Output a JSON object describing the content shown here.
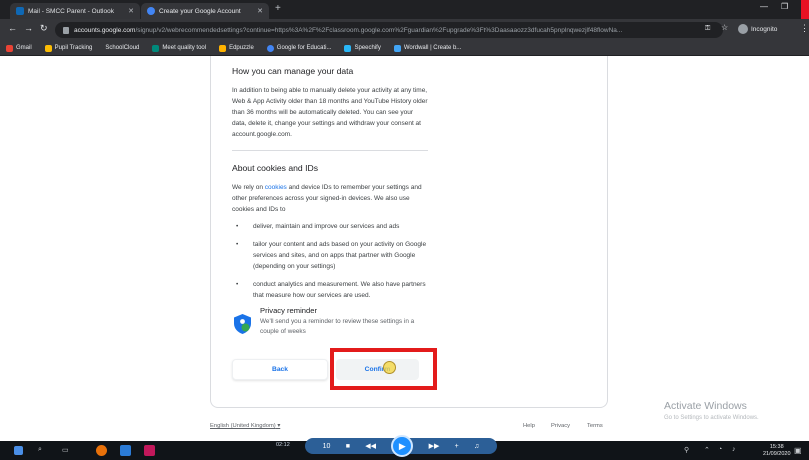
{
  "browser": {
    "tabs": [
      {
        "title": "Mail - SMCC Parent - Outlook",
        "favicon_color": "#0f6cbd"
      },
      {
        "title": "Create your Google Account",
        "favicon_color": "#4285f4"
      }
    ],
    "url_host": "accounts.google.com",
    "url_path": "/signup/v2/webrecommendedsettings?continue=https%3A%2F%2Fclassroom.google.com%2Fguardian%2Fupgrade%3Ft%3Daasaaozz3dfucah5pnplnqwezjlf48flowNa...",
    "profile_label": "Incognito",
    "bookmarks": [
      {
        "label": "Gmail",
        "color": "#ea4335"
      },
      {
        "label": "Pupil Tracking",
        "color": "#fbbc04"
      },
      {
        "label": "SchoolCloud",
        "color": "#7cb342"
      },
      {
        "label": "Meet quality tool",
        "color": "#00897b"
      },
      {
        "label": "Edpuzzle",
        "color": "#ffb300"
      },
      {
        "label": "Google for Educati...",
        "color": "#4285f4"
      },
      {
        "label": "Speechify",
        "color": "#29b6f6"
      },
      {
        "label": "Wordwall | Create b...",
        "color": "#42a5f5"
      }
    ]
  },
  "manage": {
    "heading": "How you can manage your data",
    "body": "In addition to being able to manually delete your activity at any time, Web & App Activity older than 18 months and YouTube History older than 36 months will be automatically deleted. You can see your data, delete it, change your settings and withdraw your consent at account.google.com."
  },
  "cookies": {
    "heading": "About cookies and IDs",
    "intro_before": "We rely on ",
    "intro_link": "cookies",
    "intro_after": " and device IDs to remember your settings and other preferences across your signed-in devices. We also use cookies and IDs to",
    "bullets": [
      "deliver, maintain and improve our services and ads",
      "tailor your content and ads based on your activity on Google services and sites, and on apps that partner with Google (depending on your settings)",
      "conduct analytics and measurement. We also have partners that measure how our services are used."
    ]
  },
  "reminder": {
    "title": "Privacy reminder",
    "text": "We'll send you a reminder to review these settings in a couple of weeks"
  },
  "buttons": {
    "back": "Back",
    "confirm": "Confirm"
  },
  "footer": {
    "language": "English (United Kingdom)",
    "help": "Help",
    "privacy": "Privacy",
    "terms": "Terms"
  },
  "watermark": {
    "title": "Activate Windows",
    "subtitle": "Go to Settings to activate Windows."
  },
  "player": {
    "time": "02:12",
    "time_end": "10"
  },
  "taskbar": {
    "clock_time": "15:38",
    "clock_date": "21/09/2020"
  },
  "colors": {
    "accent": "#1a73e8",
    "highlight_box": "#e31b1b"
  }
}
